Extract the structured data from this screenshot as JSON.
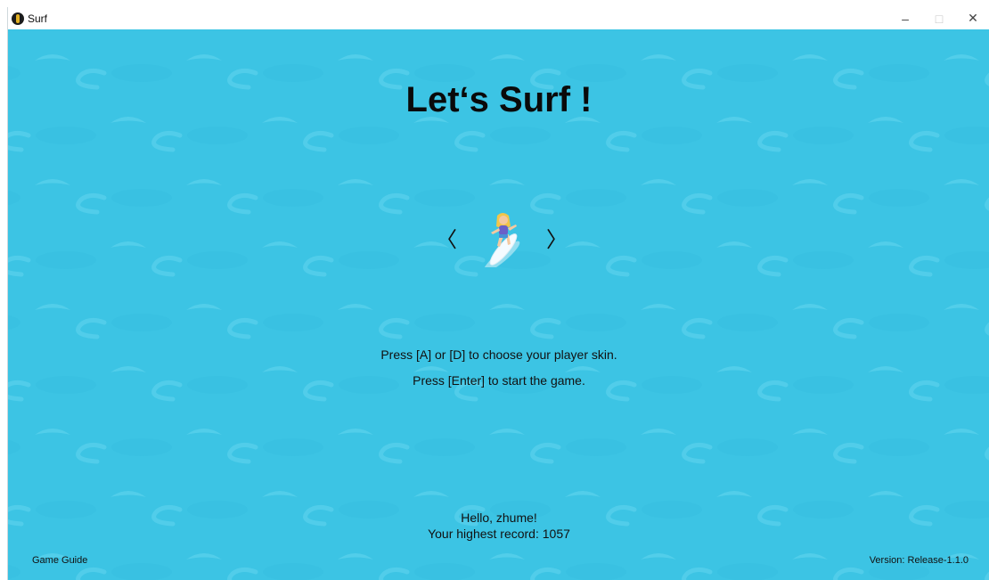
{
  "window": {
    "title": "Surf",
    "minimize_glyph": "–",
    "maximize_glyph": "□",
    "close_glyph": "✕"
  },
  "game": {
    "heading": "Let‘s Surf !",
    "prev_skin_glyph": "〈",
    "next_skin_glyph": "〉",
    "skin_icon": "surfer-icon",
    "instructions": [
      "Press [A] or [D] to choose your player skin.",
      "Press [Enter] to start the game."
    ],
    "greeting": "Hello, zhume!",
    "record_text": "Your highest record: 1057",
    "guide_label": "Game Guide",
    "version_label": "Version: Release-1.1.0"
  },
  "colors": {
    "ocean": "#3cc4e4",
    "wave_light": "#5ad2ec",
    "wave_dark": "#2fb6d8"
  }
}
